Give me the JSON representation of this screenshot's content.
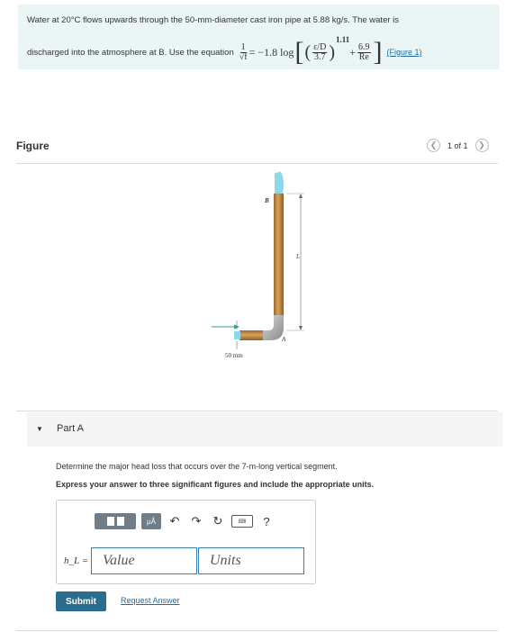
{
  "problem": {
    "line1": "Water at 20°C flows upwards through the 50-mm-diameter cast iron pipe at 5.88 kg/s. The water is",
    "line2_prefix": "discharged into the atmosphere at B. Use the equation",
    "eq_lhs_num": "1",
    "eq_lhs_den": "√f",
    "eq_middle": "= −1.8 log",
    "eq_frac1_num": "ε/D",
    "eq_frac1_den": "3.7",
    "eq_exponent": "1.11",
    "eq_plus": "+",
    "eq_frac2_num": "6.9",
    "eq_frac2_den": "Re",
    "figure_link": "(Figure 1)"
  },
  "figure": {
    "title": "Figure",
    "pager_text": "1 of 1",
    "labels": {
      "top": "B",
      "length": "L",
      "elbow": "A",
      "diameter": "50 mm"
    }
  },
  "part": {
    "label": "Part A",
    "question": "Determine the major head loss that occurs over the 7-m-long vertical segment.",
    "instruction": "Express your answer to three significant figures and include the appropriate units."
  },
  "answer": {
    "variable": "h_L =",
    "value_placeholder": "Value",
    "units_placeholder": "Units",
    "mu_label": "μÅ",
    "help_label": "?"
  },
  "actions": {
    "submit_label": "Submit",
    "request_label": "Request Answer"
  },
  "colors": {
    "accent": "#2a6e8f",
    "link": "#1a6ea8",
    "pipe": "#c8904a",
    "water": "#7fd0e6",
    "problem_bg": "#eaf6f6"
  }
}
